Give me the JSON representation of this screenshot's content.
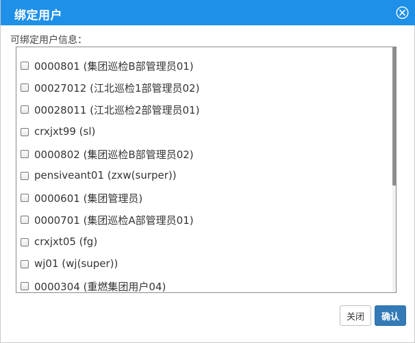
{
  "dialog": {
    "title": "绑定用户",
    "close_icon": "circle-x-icon"
  },
  "section": {
    "label": "可绑定用户信息："
  },
  "users": [
    {
      "label": "0000801 (集团巡检B部管理员01)",
      "checked": false
    },
    {
      "label": "00027012 (江北巡检1部管理员02)",
      "checked": false
    },
    {
      "label": "00028011 (江北巡检2部管理员01)",
      "checked": false
    },
    {
      "label": "crxjxt99 (sl)",
      "checked": false
    },
    {
      "label": "0000802 (集团巡检B部管理员02)",
      "checked": false
    },
    {
      "label": "pensiveant01 (zxw(surper))",
      "checked": false
    },
    {
      "label": "0000601 (集团管理员)",
      "checked": false
    },
    {
      "label": "0000701 (集团巡检A部管理员01)",
      "checked": false
    },
    {
      "label": "crxjxt05 (fg)",
      "checked": false
    },
    {
      "label": "wj01 (wj(super))",
      "checked": false
    },
    {
      "label": "0000304 (重燃集团用户04)",
      "checked": false
    }
  ],
  "footer": {
    "close_label": "关闭",
    "confirm_label": "确认"
  },
  "colors": {
    "titlebar": "#1e90e8",
    "confirm_button": "#337ab7"
  }
}
